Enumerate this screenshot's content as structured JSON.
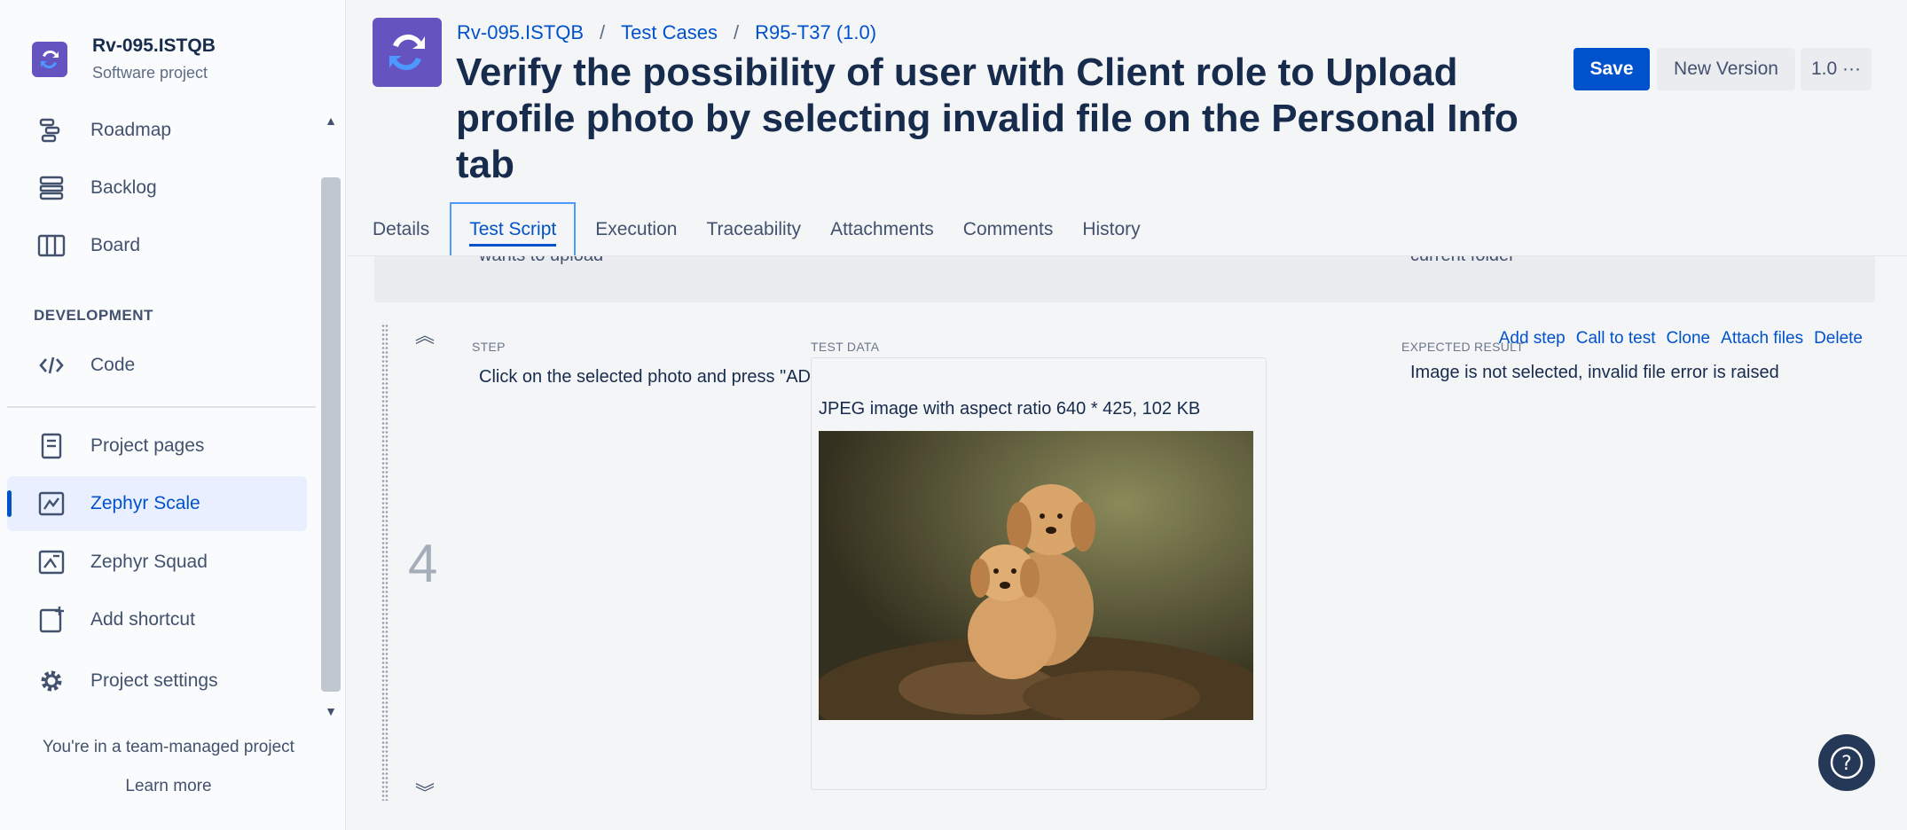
{
  "sidebar": {
    "project_name": "Rv-095.ISTQB",
    "project_type": "Software project",
    "items_top": [
      {
        "label": "Roadmap",
        "icon": "roadmap-icon"
      },
      {
        "label": "Backlog",
        "icon": "backlog-icon"
      },
      {
        "label": "Board",
        "icon": "board-icon"
      }
    ],
    "section_development": "DEVELOPMENT",
    "code_label": "Code",
    "items_bottom": [
      {
        "label": "Project pages",
        "icon": "page-icon"
      },
      {
        "label": "Zephyr Scale",
        "icon": "zephyr-scale-icon",
        "active": true
      },
      {
        "label": "Zephyr Squad",
        "icon": "zephyr-squad-icon"
      },
      {
        "label": "Add shortcut",
        "icon": "add-shortcut-icon"
      },
      {
        "label": "Project settings",
        "icon": "gear-icon"
      }
    ],
    "team_note": "You're in a team-managed project",
    "learn_more": "Learn more"
  },
  "header": {
    "breadcrumb": [
      "Rv-095.ISTQB",
      "Test Cases",
      "R95-T37 (1.0)"
    ],
    "title": "Verify the possibility of user with Client role to Upload profile photo by selecting invalid file on the Personal Info tab",
    "save_label": "Save",
    "new_version_label": "New Version",
    "version_label": "1.0",
    "more_icon": "more-icon"
  },
  "tabs": [
    "Details",
    "Test Script",
    "Execution",
    "Traceability",
    "Attachments",
    "Comments",
    "History"
  ],
  "active_tab": "Test Script",
  "prev_row": {
    "step_text_cut": "wants to upload",
    "expected_text_cut": "current folder"
  },
  "step": {
    "number": "4",
    "labels": {
      "step": "STEP",
      "test_data": "TEST DATA",
      "expected": "EXPECTED RESULT"
    },
    "step_text": "Click on the selected photo and press \"ADD\" button",
    "test_data_text": "JPEG image with aspect ratio 640 * 425, 102 KB",
    "expected_text": "Image is not selected, invalid file error is raised",
    "actions": [
      "Add step",
      "Call to test",
      "Clone",
      "Attach files",
      "Delete"
    ]
  },
  "colors": {
    "accent": "#0052cc",
    "sidebar_active_bg": "#e9efff",
    "project_avatar": "#6554c0"
  }
}
